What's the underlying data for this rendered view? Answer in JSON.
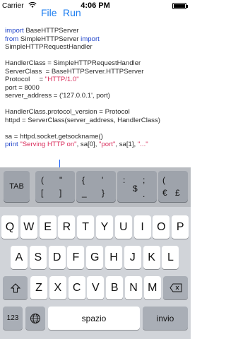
{
  "status": {
    "carrier": "Carrier",
    "time": "4:06 PM"
  },
  "nav": {
    "file": "File",
    "run": "Run"
  },
  "code_lines": [
    [
      {
        "t": "import",
        "c": "kw"
      },
      {
        "t": " BaseHTTPServer",
        "c": ""
      }
    ],
    [
      {
        "t": "from",
        "c": "kw"
      },
      {
        "t": " SimpleHTTPServer ",
        "c": ""
      },
      {
        "t": "import",
        "c": "kw"
      }
    ],
    [
      {
        "t": "SimpleHTTPRequestHandler",
        "c": ""
      }
    ],
    [
      {
        "t": "",
        "c": ""
      }
    ],
    [
      {
        "t": "HandlerClass = SimpleHTTPRequestHandler",
        "c": ""
      }
    ],
    [
      {
        "t": "ServerClass  = BaseHTTPServer.HTTPServer",
        "c": ""
      }
    ],
    [
      {
        "t": "Protocol     = ",
        "c": ""
      },
      {
        "t": "\"HTTP/1.0\"",
        "c": "str"
      }
    ],
    [
      {
        "t": "port = 8000",
        "c": ""
      }
    ],
    [
      {
        "t": "server_address = ('127.0.0.1', port)",
        "c": ""
      }
    ],
    [
      {
        "t": "",
        "c": ""
      }
    ],
    [
      {
        "t": "HandlerClass.protocol_version = Protocol",
        "c": ""
      }
    ],
    [
      {
        "t": "httpd = ServerClass(server_address, HandlerClass)",
        "c": ""
      }
    ],
    [
      {
        "t": "",
        "c": ""
      }
    ],
    [
      {
        "t": "sa = httpd.socket.getsockname()",
        "c": ""
      }
    ],
    [
      {
        "t": "print",
        "c": "kw"
      },
      {
        "t": " ",
        "c": ""
      },
      {
        "t": "\"Serving HTTP on\"",
        "c": "str"
      },
      {
        "t": ", sa[0], ",
        "c": ""
      },
      {
        "t": "\"port\"",
        "c": "str"
      },
      {
        "t": ", sa[1], ",
        "c": ""
      },
      {
        "t": "\"...\"",
        "c": "str"
      }
    ]
  ],
  "accessory": {
    "tab": "TAB",
    "k1": [
      "(",
      "\"",
      "[",
      "]"
    ],
    "k2": [
      "{",
      "'",
      "_",
      "}"
    ],
    "k3": [
      ":",
      ";",
      "$",
      "."
    ],
    "k4": [
      "(",
      "€",
      "£"
    ]
  },
  "keyboard": {
    "row1": [
      "Q",
      "W",
      "E",
      "R",
      "T",
      "Y",
      "U",
      "I",
      "O",
      "P"
    ],
    "row2": [
      "A",
      "S",
      "D",
      "F",
      "G",
      "H",
      "J",
      "K",
      "L"
    ],
    "row3": [
      "Z",
      "X",
      "C",
      "V",
      "B",
      "N",
      "M"
    ],
    "num_key": "123",
    "globe_icon": "globe-icon",
    "space_label": "spazio",
    "return_label": "invio",
    "shift_icon": "shift-icon",
    "delete_icon": "delete-icon"
  }
}
